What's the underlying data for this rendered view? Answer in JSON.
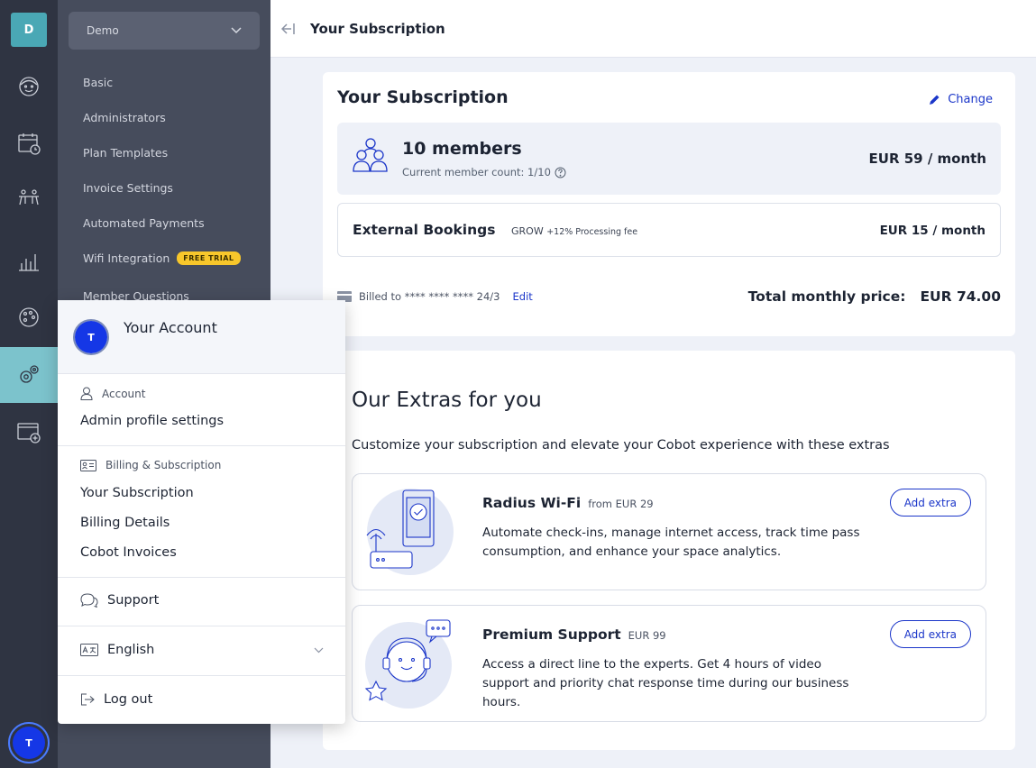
{
  "rail": {
    "logo_letter": "D",
    "avatar_letter": "T"
  },
  "sidebar": {
    "org_name": "Demo",
    "items": [
      {
        "label": "Basic"
      },
      {
        "label": "Administrators"
      },
      {
        "label": "Plan Templates"
      },
      {
        "label": "Invoice Settings"
      },
      {
        "label": "Automated Payments"
      },
      {
        "label": "Wifi Integration",
        "badge": "FREE TRIAL"
      },
      {
        "label": "Member Questions"
      }
    ]
  },
  "header": {
    "title": "Your Subscription"
  },
  "subscription": {
    "title": "Your Subscription",
    "change_label": "Change",
    "members_title": "10 members",
    "members_sub": "Current member count: 1/10",
    "members_price": "EUR 59 / month",
    "ext_title": "External Bookings",
    "ext_plan": "GROW",
    "ext_fee": "+12% Processing fee",
    "ext_price": "EUR 15 / month",
    "billed_text": "Billed to **** **** **** 24/3",
    "edit_label": "Edit",
    "total_label": "Total monthly price:",
    "total_value": "EUR 74.00"
  },
  "extras": {
    "title": "Our Extras for you",
    "description": "Customize your subscription and elevate your Cobot experience with these extras",
    "items": [
      {
        "name": "Radius Wi-Fi",
        "price": "from EUR 29",
        "description": "Automate check-ins, manage internet access, track time pass consumption, and enhance your space analytics.",
        "button": "Add extra"
      },
      {
        "name": "Premium Support",
        "price": "EUR 99",
        "description": "Access a direct line to the experts. Get 4 hours of video support and priority chat response time during our business hours.",
        "button": "Add extra"
      }
    ]
  },
  "account_popup": {
    "avatar_letter": "T",
    "title": "Your Account",
    "account_section": "Account",
    "admin_profile": "Admin profile settings",
    "billing_section": "Billing & Subscription",
    "your_subscription": "Your Subscription",
    "billing_details": "Billing Details",
    "cobot_invoices": "Cobot Invoices",
    "support": "Support",
    "language": "English",
    "logout": "Log out"
  },
  "colors": {
    "accent": "#1b36c9",
    "rail_bg": "#2f3442",
    "sidebar_bg": "#464c5c",
    "active_teal": "#7cc3cc",
    "badge": "#f8c72b"
  }
}
